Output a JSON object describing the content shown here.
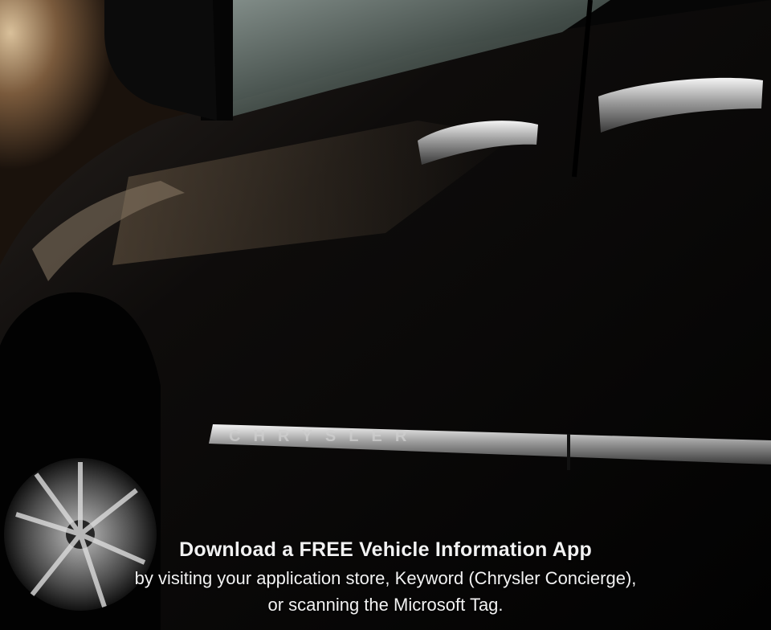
{
  "photo": {
    "subject": "Chrysler minivan side view with reflections",
    "badge_text": "CHRYSLER",
    "colors": {
      "paint": "#0a0a0a",
      "background_warm": "#c9a77c",
      "chrome": "#d8d8d8"
    }
  },
  "caption": {
    "title": "Download a FREE Vehicle Information App",
    "line1": "by visiting your application store, Keyword (Chrysler Concierge),",
    "line2": "or scanning the Microsoft Tag."
  }
}
